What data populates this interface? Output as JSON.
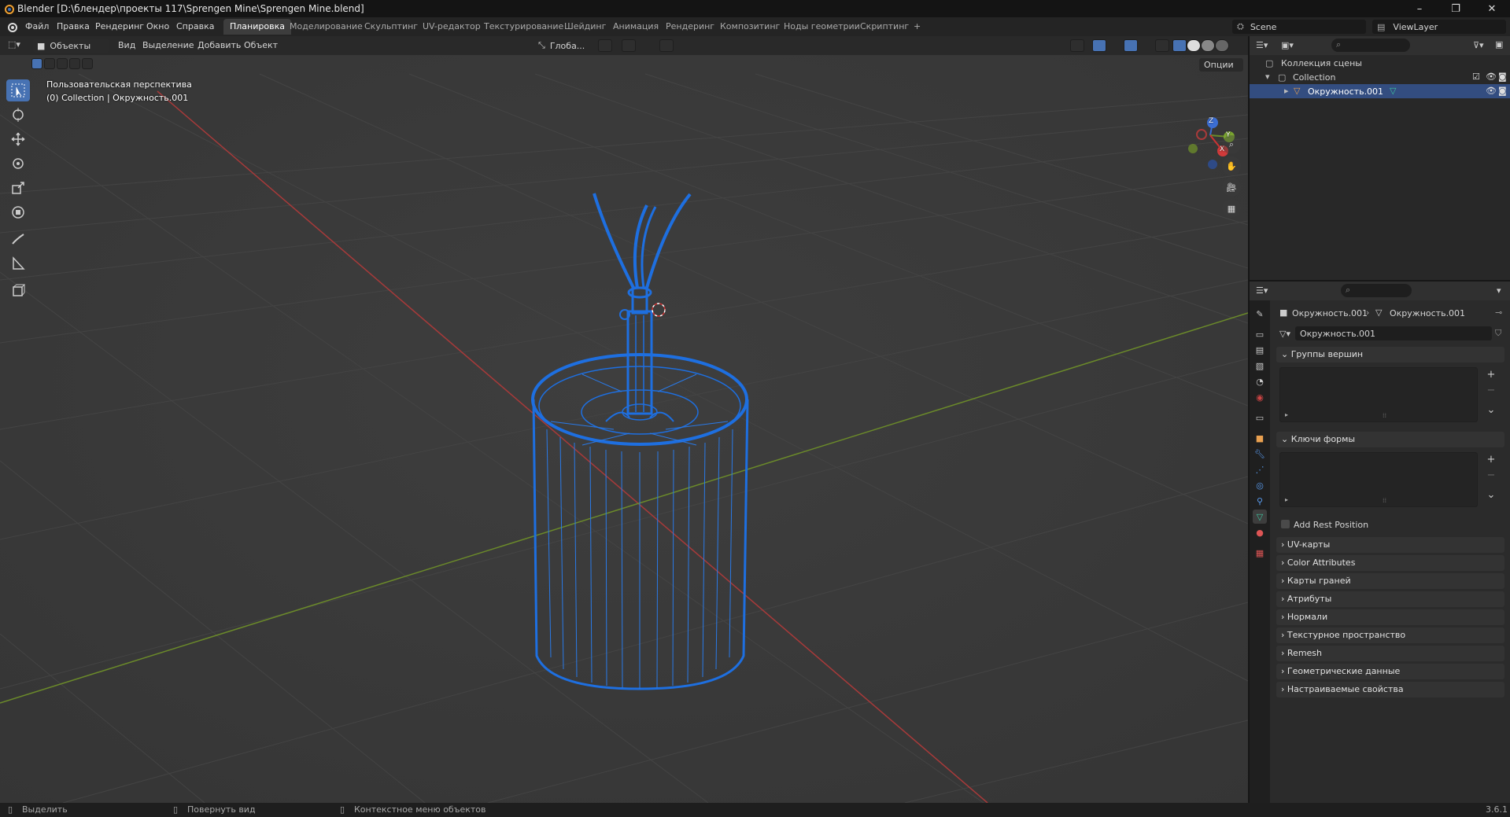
{
  "titlebar": {
    "title": "Blender [D:\\блендер\\проекты 117\\Sprengen Mine\\Sprengen Mine.blend]",
    "min": "–",
    "max": "❐",
    "close": "✕"
  },
  "menu": {
    "file": "Файл",
    "edit": "Правка",
    "render": "Рендеринг",
    "window": "Окно",
    "help": "Справка"
  },
  "workspaces": [
    "Планировка",
    "Моделирование",
    "Скульптинг",
    "UV-редактор",
    "Текстурирование",
    "Шейдинг",
    "Анимация",
    "Рендеринг",
    "Композитинг",
    "Ноды геометрии",
    "Скриптинг"
  ],
  "add_workspace": "+",
  "scene": {
    "name": "Scene",
    "view_layer": "ViewLayer"
  },
  "viewport": {
    "mode": "Объекты",
    "menus": [
      "Вид",
      "Выделение",
      "Добавить",
      "Объект"
    ],
    "orientation": "Глоба...",
    "options_label": "Опции",
    "view_name": "Пользовательская перспектива",
    "collection_info": "(0) Collection | Окружность.001",
    "gizmo": {
      "z": "Z",
      "y": "Y",
      "x": "X"
    }
  },
  "outliner": {
    "root": "Коллекция сцены",
    "collection": "Collection",
    "object": "Окружность.001"
  },
  "properties": {
    "breadcrumb_object": "Окружность.001",
    "breadcrumb_data": "Окружность.001",
    "data_name": "Окружность.001",
    "panels": {
      "vertex_groups": "Группы вершин",
      "shape_keys": "Ключи формы",
      "add_rest_position": "Add Rest Position",
      "collapsed": [
        "UV-карты",
        "Color Attributes",
        "Карты граней",
        "Атрибуты",
        "Нормали",
        "Текстурное пространство",
        "Remesh",
        "Геометрические данные",
        "Настраиваемые свойства"
      ]
    }
  },
  "statusbar": {
    "select": "Выделить",
    "rotate": "Повернуть вид",
    "context": "Контекстное меню объектов",
    "version": "3.6.1"
  },
  "colors": {
    "accent": "#4772b3",
    "wire": "#1e6fe0",
    "grid_x": "#a83a3a",
    "grid_y": "#6b8a2a"
  }
}
